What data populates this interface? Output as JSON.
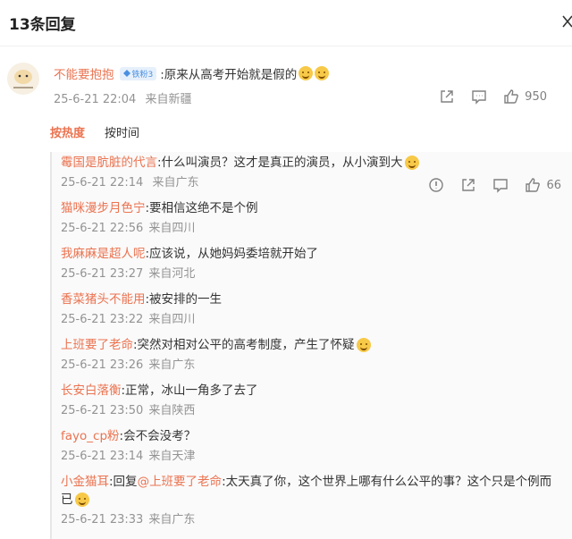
{
  "header": {
    "title": "13条回复"
  },
  "main_comment": {
    "user": "不能要抱抱",
    "badge": "铁粉3",
    "text": ":原来从高考开始就是假的",
    "time": "25-6-21 22:04",
    "location": "来自新疆",
    "like_count": "950"
  },
  "sort": {
    "hot": "按热度",
    "time": "按时间"
  },
  "replies": [
    {
      "user": "霉国是肮脏的代言",
      "text": ":什么叫演员？这才是真正的演员，从小演到大",
      "time": "25-6-21 22:14",
      "location": "来自广东",
      "like_count": "66"
    },
    {
      "user": "猫咪漫步月色宁",
      "text": ":要相信这绝不是个例",
      "time": "25-6-21 22:56",
      "location": "来自四川"
    },
    {
      "user": "我麻麻是超人呢",
      "text": ":应该说，从她妈妈委培就开始了",
      "time": "25-6-21 23:27",
      "location": "来自河北"
    },
    {
      "user": "香菜猪头不能用",
      "text": ":被安排的一生",
      "time": "25-6-21 23:22",
      "location": "来自四川"
    },
    {
      "user": "上班要了老命",
      "text": ":突然对相对公平的高考制度，产生了怀疑",
      "time": "25-6-21 23:26",
      "location": "来自广东"
    },
    {
      "user": "长安白落衡",
      "text": ":正常，冰山一角多了去了",
      "time": "25-6-21 23:50",
      "location": "来自陕西"
    },
    {
      "user": "fayo_cp粉",
      "text": ":会不会没考？",
      "time": "25-6-21 23:14",
      "location": "来自天津"
    },
    {
      "user": "小金猫耳",
      "reply_word": ":回复",
      "mention": "@上班要了老命",
      "text": ":太天真了你，这个世界上哪有什么公平的事？这个只是个例而已",
      "time": "25-6-21 23:33",
      "location": "来自广东"
    }
  ],
  "colors": {
    "accent": "#eb7350",
    "meta": "#939393",
    "badge": "#4a90e2"
  },
  "icons": [
    "close-icon",
    "share-icon",
    "comment-icon",
    "like-icon",
    "report-icon",
    "laugh-cry-emoji",
    "smirk-emoji",
    "thinking-emoji"
  ]
}
